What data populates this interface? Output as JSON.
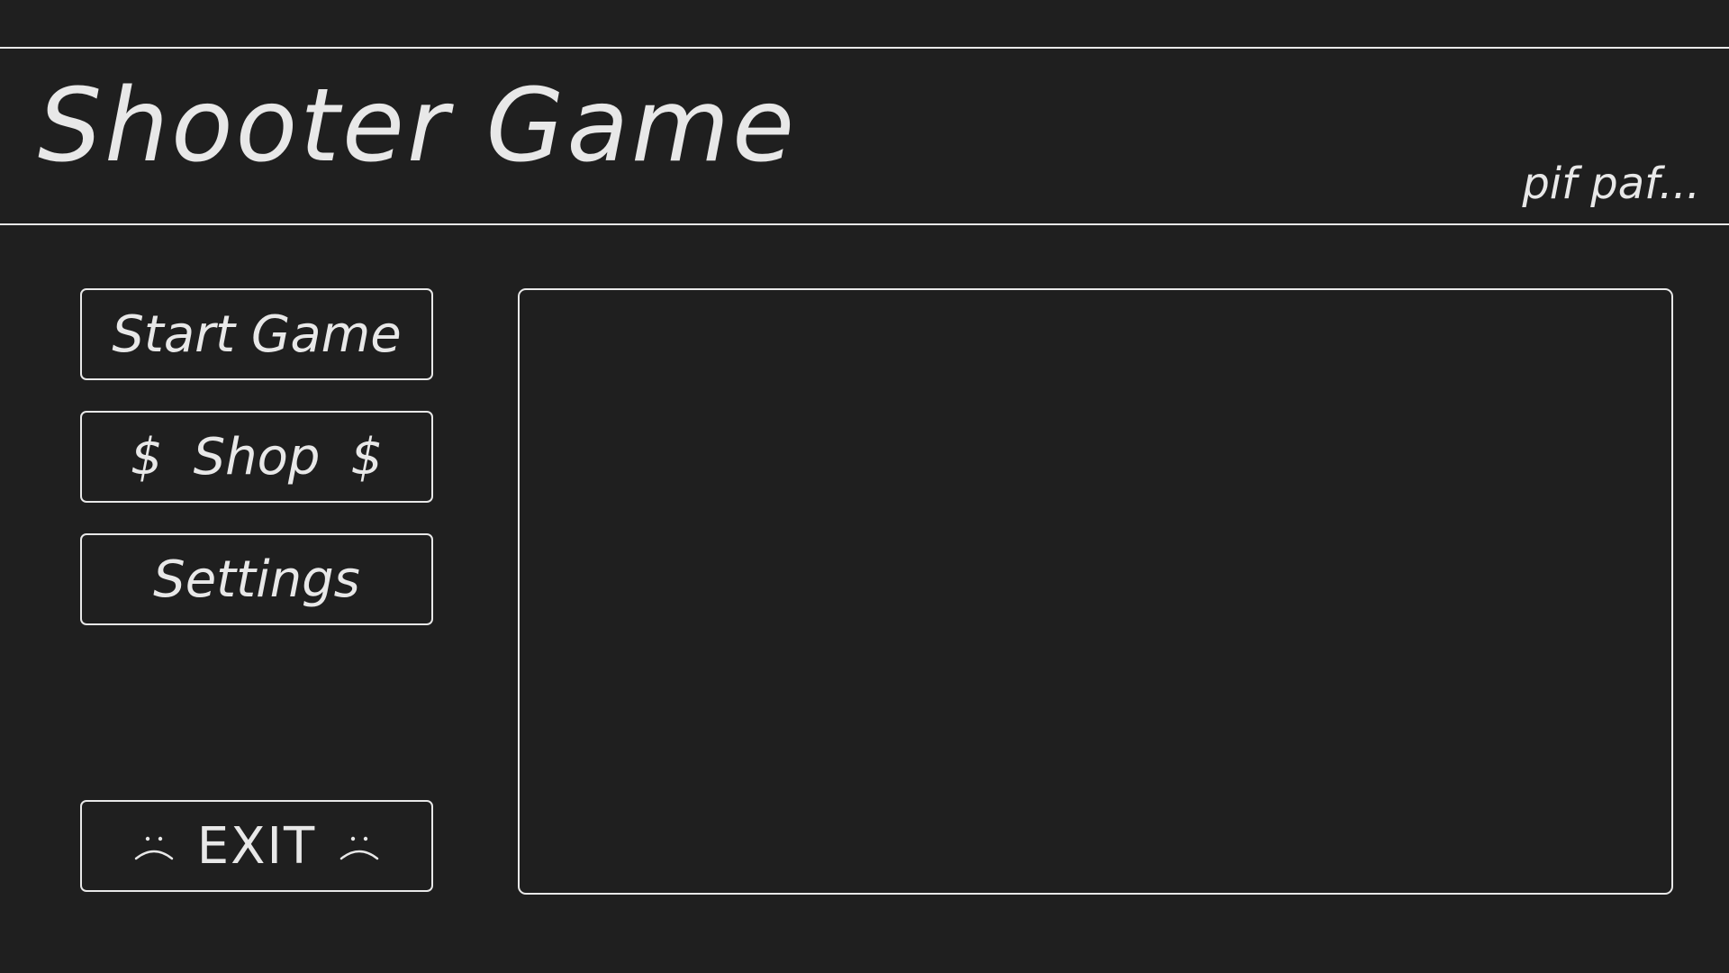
{
  "header": {
    "title": "Shooter Game",
    "tagline": "pif paf..."
  },
  "menu": {
    "start_label": "Start Game",
    "shop": {
      "prefix": "$",
      "label": "Shop",
      "suffix": "$"
    },
    "settings_label": "Settings",
    "exit": {
      "label": "EXIT",
      "left_icon": "frown-face-icon",
      "right_icon": "frown-face-icon"
    }
  },
  "colors": {
    "background": "#1f1f1f",
    "foreground": "#e8e8e8"
  }
}
